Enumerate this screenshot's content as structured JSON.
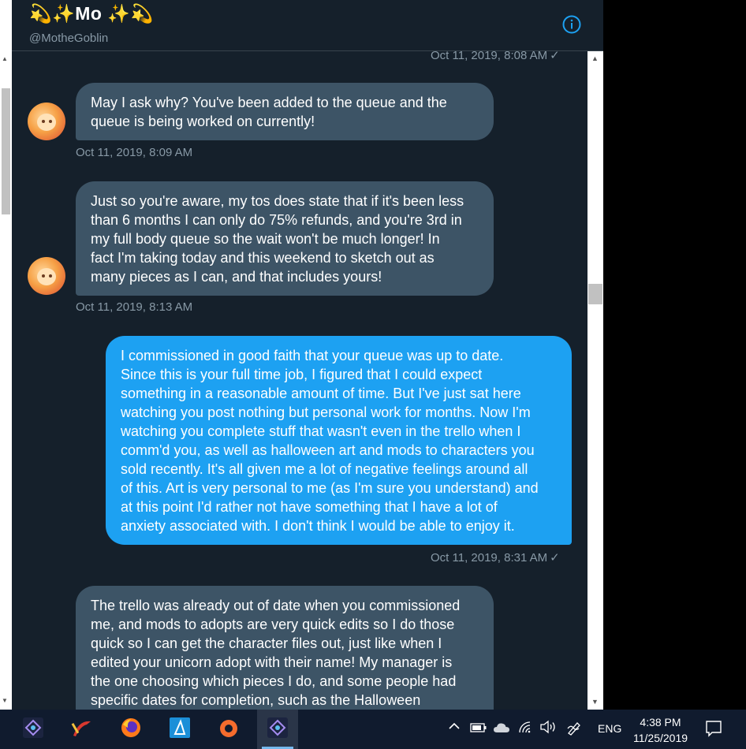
{
  "header": {
    "title": "💫✨Mo ✨💫",
    "handle": "@MotheGoblin"
  },
  "messages": [
    {
      "type": "timestamp",
      "side": "out",
      "text": "Oct 11, 2019, 8:08 AM"
    },
    {
      "type": "bubble",
      "side": "in",
      "text": "May I ask why? You've been added to the queue and the\nqueue is being worked on currently!"
    },
    {
      "type": "timestamp",
      "side": "in",
      "text": "Oct 11, 2019, 8:09 AM"
    },
    {
      "type": "bubble",
      "side": "in",
      "text": "Just so you're aware, my tos does state that if it's been less\nthan 6 months I can only do 75% refunds, and you're 3rd in\nmy full body queue so the wait won't be much longer! In\nfact I'm taking today and this weekend to sketch out as\nmany pieces as I can, and that includes yours!"
    },
    {
      "type": "timestamp",
      "side": "in",
      "text": "Oct 11, 2019, 8:13 AM"
    },
    {
      "type": "bubble",
      "side": "out",
      "text": "I commissioned in good faith that your queue was up to date.\nSince this is your full time job, I figured that I could expect\nsomething in a reasonable amount of time. But I've just sat here\nwatching you post nothing but personal work for months. Now I'm\nwatching you complete stuff that wasn't even in the trello when I\ncomm'd you, as well as halloween art and mods to characters you\nsold recently. It's all given me a lot of negative feelings around all\nof this. Art is very personal to me (as I'm sure you understand) and\nat this point I'd rather not have something that I have a lot of\nanxiety associated with. I don't think I would be able to enjoy it."
    },
    {
      "type": "timestamp",
      "side": "out",
      "text": "Oct 11, 2019, 8:31 AM"
    },
    {
      "type": "bubble",
      "side": "in",
      "text": "The trello was already out of date when you commissioned\nme, and mods to adopts are very quick edits so I do those\nquick so I can get the character files out, just like when I\nedited your unicorn adopt with their name! My manager is\nthe one choosing which pieces I do, and some people had\nspecific dates for completion, such as the Halloween"
    }
  ],
  "read_check": "✓",
  "taskbar": {
    "apps": [
      "affinity-photo",
      "sketchbook",
      "firefox",
      "affinity-designer",
      "origin",
      "affinity-photo"
    ],
    "language": "ENG",
    "time": "4:38 PM",
    "date": "11/25/2019"
  },
  "colors": {
    "background": "#15202b",
    "incoming_bubble": "#3d5466",
    "outgoing_bubble": "#1da1f2",
    "muted_text": "#8899a6",
    "taskbar": "#101b2e"
  }
}
